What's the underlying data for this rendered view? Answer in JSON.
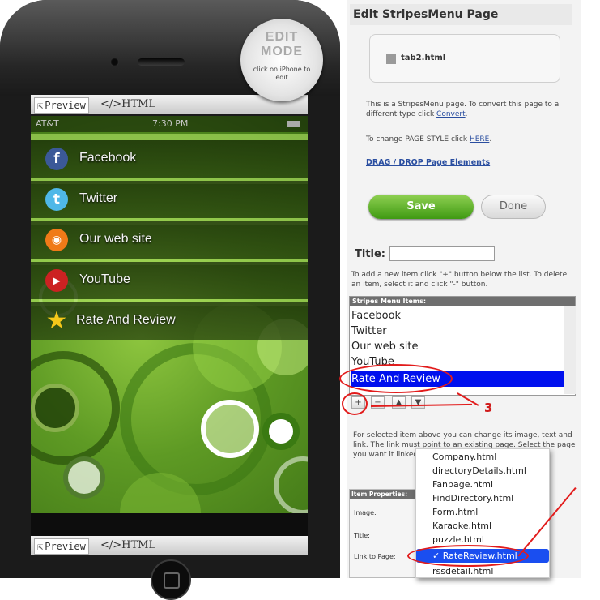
{
  "phone": {
    "toolbar_top": {
      "preview": "Preview",
      "html": "</>HTML"
    },
    "toolbar_bottom": {
      "preview": "Preview",
      "html": "</>HTML"
    },
    "badge": {
      "line1": "EDIT",
      "line2": "MODE",
      "line3": "click on iPhone to edit"
    },
    "status": {
      "carrier": "AT&T",
      "time": "7:30 PM"
    },
    "menu": [
      {
        "label": "Facebook",
        "icon": "facebook-icon",
        "glyph": "f",
        "color": "#3b5998"
      },
      {
        "label": "Twitter",
        "icon": "twitter-icon",
        "glyph": "t",
        "color": "#4fb8e8"
      },
      {
        "label": "Our web site",
        "icon": "rss-icon",
        "glyph": "◉",
        "color": "#f07a18"
      },
      {
        "label": "YouTube",
        "icon": "youtube-icon",
        "glyph": "▶",
        "color": "#cc2222"
      },
      {
        "label": "Rate And Review",
        "icon": "star-icon",
        "glyph": "★",
        "color": "#f5c81a"
      }
    ]
  },
  "editor": {
    "title": "Edit StripesMenu Page",
    "page_file": "tab2.html",
    "desc_text": "This is a StripesMenu page. To convert this page to a different type click",
    "convert_link": "Convert",
    "style_text": "To change PAGE STYLE click",
    "style_link": "HERE",
    "drag_link": "DRAG / DROP Page Elements",
    "save_label": "Save",
    "done_label": "Done",
    "title_label": "Title:",
    "title_value": "",
    "help_text": "To add a new item click \"+\" button below the list. To delete an item, select it and click \"-\" button.",
    "list_header": "Stripes Menu Items:",
    "list_items": [
      "Facebook",
      "Twitter",
      "Our web site",
      "YouTube",
      "Rate And Review"
    ],
    "selected_index": 4,
    "controls": {
      "add": "+",
      "remove": "−",
      "up": "▲",
      "down": "▼"
    },
    "selected_help": "For selected item above you can change its image, text and link. The link must point to an existing page. Select the page you want it linked to.",
    "props_header": "Item Properties:",
    "prop_labels": {
      "image": "Image:",
      "title": "Title:",
      "link": "Link to Page:"
    },
    "dropdown": [
      "Company.html",
      "directoryDetails.html",
      "Fanpage.html",
      "FindDirectory.html",
      "Form.html",
      "Karaoke.html",
      "puzzle.html",
      "RateReview.html",
      "rssdetail.html"
    ],
    "dropdown_selected": "RateReview.html",
    "annotation": "3"
  }
}
